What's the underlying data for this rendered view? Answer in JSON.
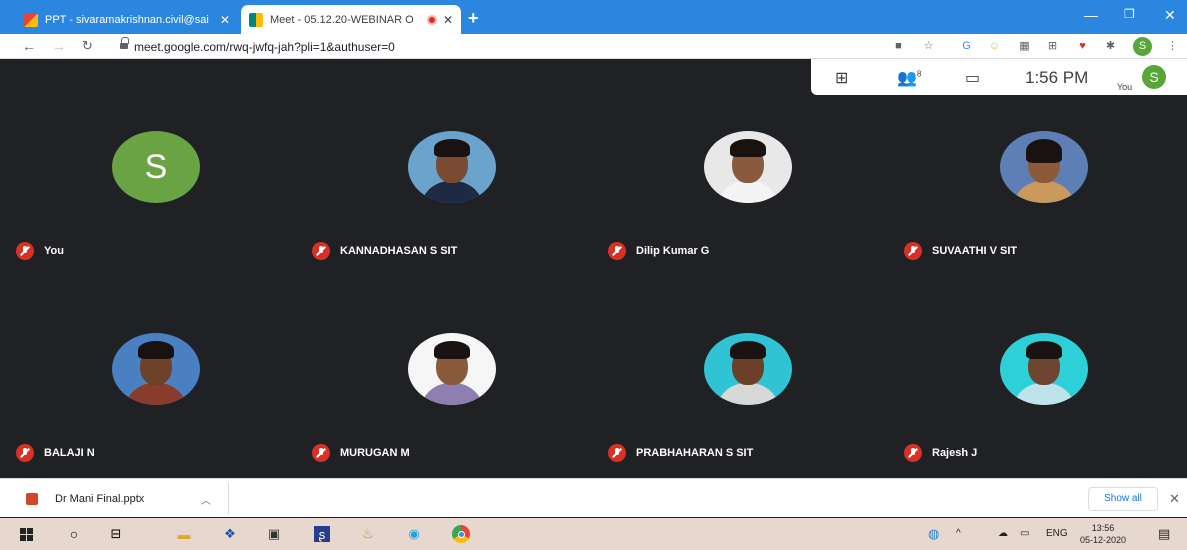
{
  "browser": {
    "tabs": [
      {
        "title": "PPT - sivaramakrishnan.civil@sai",
        "active": false
      },
      {
        "title": "Meet - 05.12.20-WEBINAR O",
        "active": true
      }
    ],
    "url": "meet.google.com/rwq-jwfq-jah?pli=1&authuser=0",
    "profile_initial": "S"
  },
  "meet": {
    "people_count": "8",
    "time": "1:56 PM",
    "you_label": "You",
    "you_initial": "S",
    "participants": [
      {
        "name": "You",
        "avatar": "letter",
        "initial": "S",
        "muted": true
      },
      {
        "name": "KANNADHASAN S SIT",
        "avatar": "photo",
        "muted": true
      },
      {
        "name": "Dilip Kumar G",
        "avatar": "photo",
        "muted": true
      },
      {
        "name": "SUVAATHI V SIT",
        "avatar": "photo",
        "muted": true
      },
      {
        "name": "BALAJI N",
        "avatar": "photo",
        "muted": true
      },
      {
        "name": "MURUGAN M",
        "avatar": "photo",
        "muted": true
      },
      {
        "name": "PRABHAHARAN S SIT",
        "avatar": "photo",
        "muted": true
      },
      {
        "name": "Rajesh J",
        "avatar": "photo",
        "muted": true
      }
    ]
  },
  "downloads": {
    "file_name": "Dr Mani Final.pptx",
    "show_all_label": "Show all"
  },
  "taskbar": {
    "language": "ENG",
    "time": "13:56",
    "date": "05-12-2020"
  },
  "colors": {
    "tab_strip": "#2b86e0",
    "meet_bg": "#202124",
    "muted_red": "#d93025",
    "avatar_green": "#6aa343"
  }
}
